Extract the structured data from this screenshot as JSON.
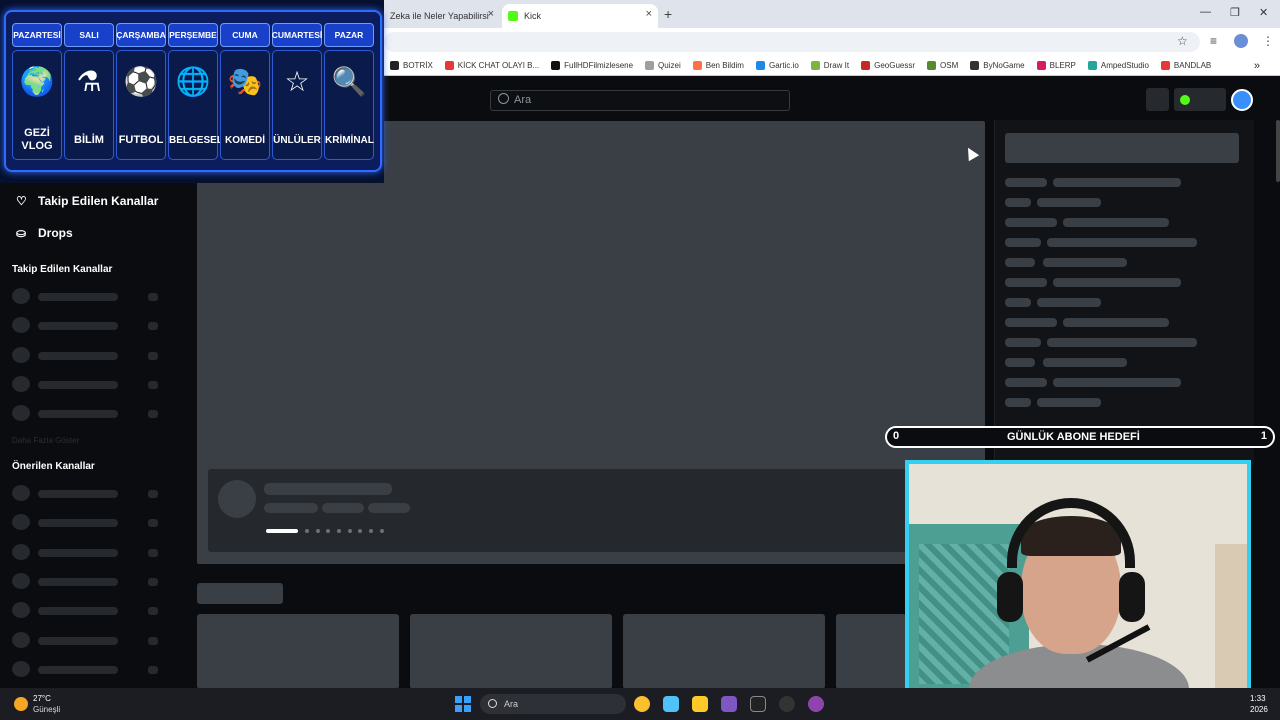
{
  "browser": {
    "tabs": [
      {
        "title": "Zeka ile Neler Yapabilirsi",
        "active": false
      },
      {
        "title": "Kick",
        "active": true
      }
    ],
    "bookmarks": [
      {
        "label": "BOTRİX",
        "color": "#222222"
      },
      {
        "label": "KİCK CHAT OLAYI B...",
        "color": "#e53935"
      },
      {
        "label": "FullHDFilmizlesene",
        "color": "#111111"
      },
      {
        "label": "Quizei",
        "color": "#9e9e9e"
      },
      {
        "label": "Ben Bildim",
        "color": "#ff7043"
      },
      {
        "label": "Gartic.io",
        "color": "#1e88e5"
      },
      {
        "label": "Draw It",
        "color": "#7cb342"
      },
      {
        "label": "GeoGuessr",
        "color": "#c62828"
      },
      {
        "label": "OSM",
        "color": "#558b2f"
      },
      {
        "label": "ByNoGame",
        "color": "#333333"
      },
      {
        "label": "BLERP",
        "color": "#d81b60"
      },
      {
        "label": "AmpedStudio",
        "color": "#26a69a"
      },
      {
        "label": "BANDLAB",
        "color": "#e53935"
      }
    ]
  },
  "schedule": {
    "days": [
      "PAZARTESİ",
      "SALI",
      "ÇARŞAMBA",
      "PERŞEMBE",
      "CUMA",
      "CUMARTESİ",
      "PAZAR"
    ],
    "cards": [
      {
        "label": "GEZİ VLOG",
        "icon": "globe-plane-icon",
        "glyph": "🌍"
      },
      {
        "label": "BİLİM",
        "icon": "science-icon",
        "glyph": "⚗"
      },
      {
        "label": "FUTBOL",
        "icon": "football-icon",
        "glyph": "⚽"
      },
      {
        "label": "BELGESEL",
        "icon": "earth-icon",
        "glyph": "🌐"
      },
      {
        "label": "KOMEDİ",
        "icon": "comedy-mask-icon",
        "glyph": "🎭"
      },
      {
        "label": "ÜNLÜLER",
        "icon": "star-icon",
        "glyph": "☆"
      },
      {
        "label": "KRİMİNAL",
        "icon": "magnifier-fingerprint-icon",
        "glyph": "🔍"
      }
    ]
  },
  "kick": {
    "search_placeholder": "Ara",
    "sidebar": {
      "followed_link": "Takip Edilen Kanallar",
      "drops_link": "Drops",
      "followed_heading": "Takip Edilen Kanallar",
      "faded_text": "Daha Fazla Göster",
      "recommended_heading": "Önerilen Kanallar"
    }
  },
  "goal": {
    "current": "0",
    "title": "GÜNLÜK ABONE HEDEFİ",
    "target": "1"
  },
  "taskbar": {
    "temperature": "27°C",
    "weather": "Güneşli",
    "search_placeholder": "Ara",
    "time": "1:33",
    "year": "2026"
  },
  "colors": {
    "kick_green": "#53fc18",
    "schedule_blue": "#1840c8",
    "webcam_border": "#34d0f2"
  }
}
